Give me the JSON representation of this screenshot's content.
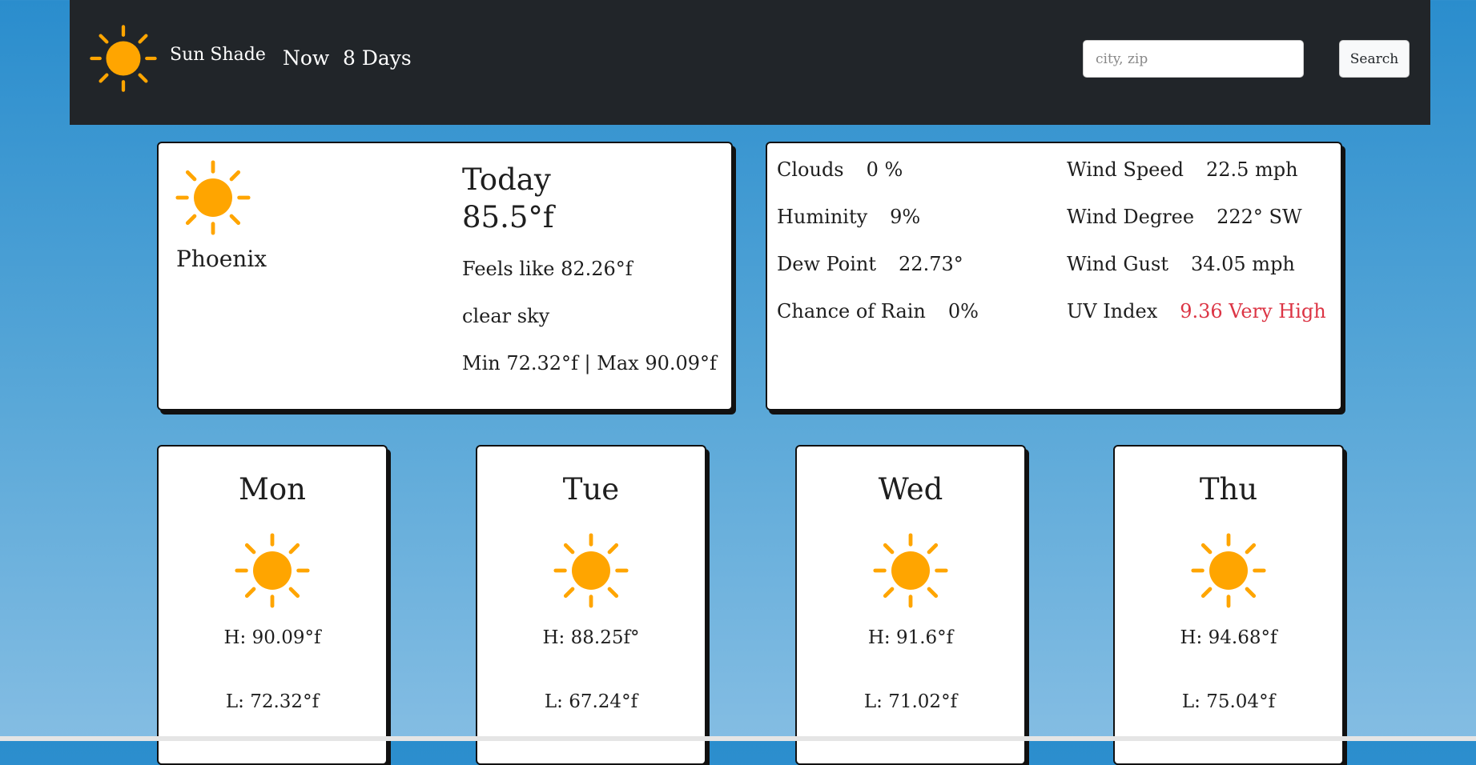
{
  "brand": {
    "name": "Sun Shade",
    "icon": "sun-icon",
    "icon_color": "#FFA500"
  },
  "nav": {
    "items": [
      "Now",
      "8 Days"
    ]
  },
  "search": {
    "placeholder": "city, zip",
    "button_label": "Search"
  },
  "today": {
    "city": "Phoenix",
    "title": "Today",
    "temp": "85.5°f",
    "feels_like": "Feels like 82.26°f",
    "description": "clear sky",
    "min_max": "Min 72.32°f | Max 90.09°f",
    "icon": "sun-icon"
  },
  "details": {
    "left": [
      {
        "label": "Clouds",
        "value": "0 %"
      },
      {
        "label": "Huminity",
        "value": "9%"
      },
      {
        "label": "Dew Point",
        "value": "22.73°"
      },
      {
        "label": "Chance of Rain",
        "value": "0%"
      }
    ],
    "right": [
      {
        "label": "Wind Speed",
        "value": "22.5 mph"
      },
      {
        "label": "Wind Degree",
        "value": "222° SW"
      },
      {
        "label": "Wind Gust",
        "value": "34.05 mph"
      },
      {
        "label": "UV Index",
        "value": "9.36 Very High"
      }
    ],
    "uv_color": "#dc3545"
  },
  "forecast": [
    {
      "day": "Mon",
      "high": "H: 90.09°f",
      "low": "L: 72.32°f",
      "icon": "sun-icon"
    },
    {
      "day": "Tue",
      "high": "H: 88.25f°",
      "low": "L: 67.24°f",
      "icon": "sun-icon"
    },
    {
      "day": "Wed",
      "high": "H: 91.6°f",
      "low": "L: 71.02°f",
      "icon": "sun-icon"
    },
    {
      "day": "Thu",
      "high": "H: 94.68°f",
      "low": "L: 75.04°f",
      "icon": "sun-icon"
    }
  ]
}
